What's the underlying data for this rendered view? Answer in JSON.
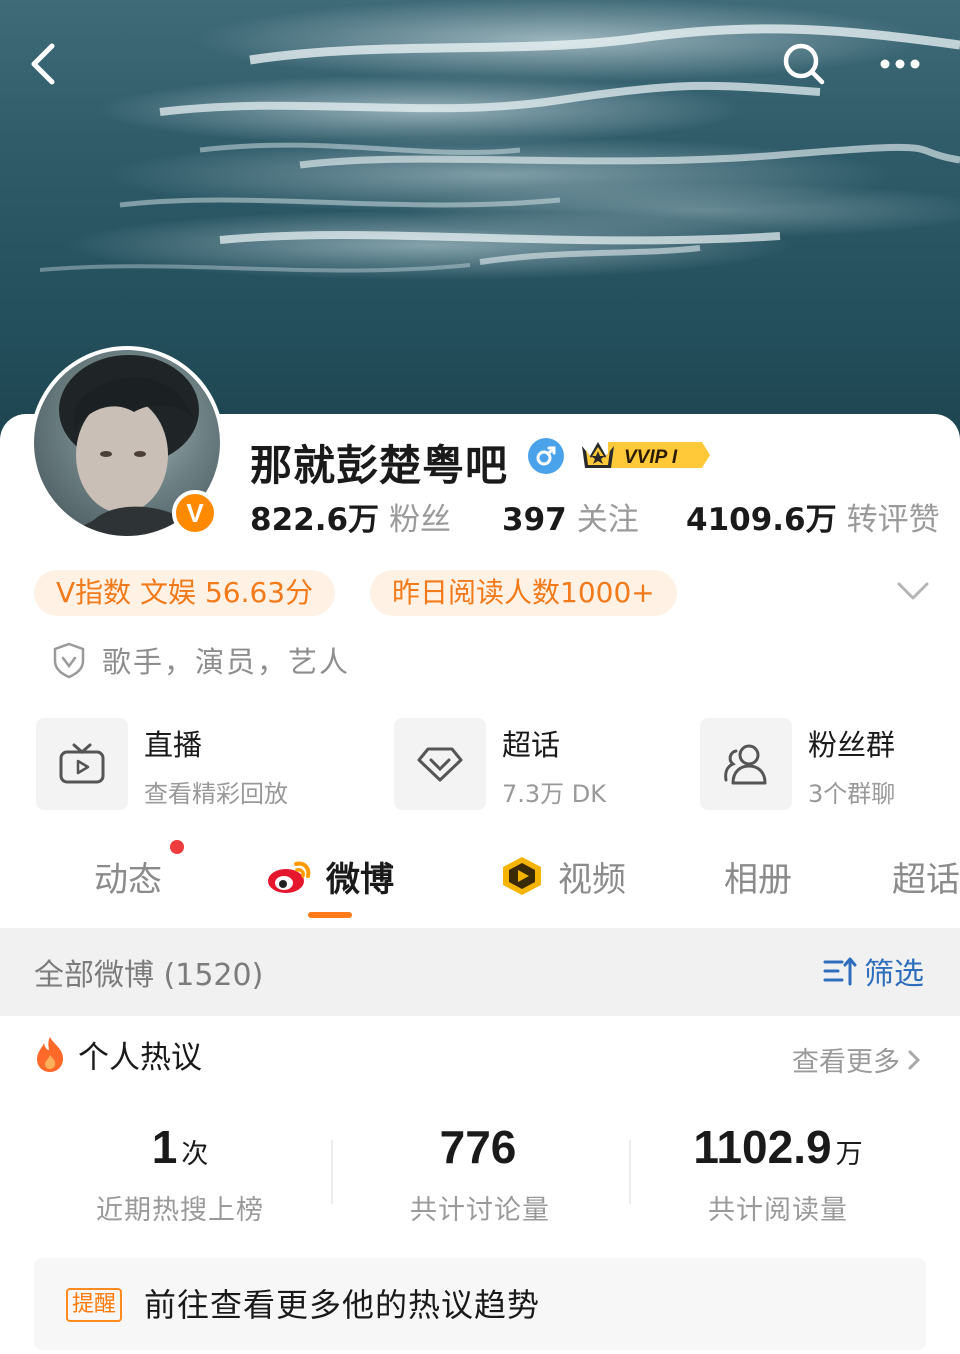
{
  "nav": {
    "back_icon": "back-arrow-icon",
    "search_icon": "search-icon",
    "more_icon": "more-dots-icon"
  },
  "profile": {
    "name": "那就彭楚粤吧",
    "verified_badge": "V",
    "vip_badge": "VVIP I",
    "gender": "male",
    "stats": [
      {
        "value": "822.6万",
        "label": "粉丝"
      },
      {
        "value": "397",
        "label": "关注"
      },
      {
        "value": "4109.6万",
        "label": "转评赞"
      }
    ],
    "tags": [
      "V指数 文娱 56.63分",
      "昨日阅读人数1000+"
    ],
    "certification": "歌手，演员，艺人"
  },
  "features": [
    {
      "title": "直播",
      "subtitle": "查看精彩回放",
      "icon": "tv-icon"
    },
    {
      "title": "超话",
      "subtitle": "7.3万 DK",
      "icon": "diamond-icon"
    },
    {
      "title": "粉丝群",
      "subtitle": "3个群聊",
      "icon": "group-icon"
    }
  ],
  "tabs": [
    "动态",
    "微博",
    "视频",
    "相册",
    "超话"
  ],
  "active_tab": "微博",
  "weibo_bar": {
    "all_label": "全部微博 (1520)",
    "filter_label": "筛选"
  },
  "hot": {
    "title": "个人热议",
    "more_label": "查看更多",
    "metrics": [
      {
        "value": "1",
        "unit": "次",
        "label": "近期热搜上榜"
      },
      {
        "value": "776",
        "unit": "",
        "label": "共计讨论量"
      },
      {
        "value": "1102.9",
        "unit": "万",
        "label": "共计阅读量"
      }
    ],
    "reminder_badge": "提醒",
    "reminder_text": "前往查看更多他的热议趋势"
  },
  "colors": {
    "accent": "#ff7a1a",
    "link_blue": "#2f6ebd",
    "tag_bg": "#fff2e5",
    "tag_text": "#f27a1a"
  }
}
